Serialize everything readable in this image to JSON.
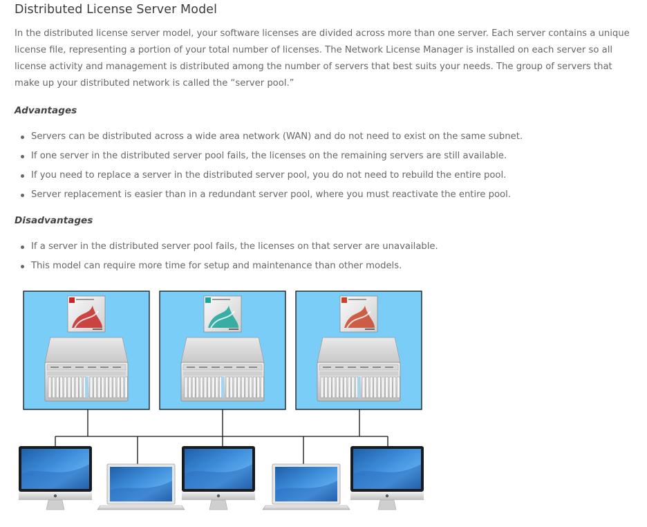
{
  "title": "Distributed License Server Model",
  "intro": "In the distributed license server model, your software licenses are divided across more than one server. Each server contains a unique license file, representing a portion of your total number of licenses. The Network License Manager is installed on each server so all license activity and management is distributed among the number of servers that best suits your needs. The group of servers that make up your distributed network is called the “server pool.”",
  "advantages": {
    "heading": "Advantages",
    "items": [
      "Servers can be distributed across a wide area network (WAN) and do not need to exist on the same subnet.",
      "If one server in the distributed server pool fails, the licenses on the remaining servers are still available.",
      "If you need to replace a server in the distributed server pool, you do not need to rebuild the entire pool.",
      "Server replacement is easier than in a redundant server pool, where you must reactivate the entire pool."
    ]
  },
  "disadvantages": {
    "heading": "Disadvantages",
    "items": [
      "If a server in the distributed server pool fails, the licenses on that server are unavailable.",
      "This model can require more time for setup and maintenance than other models."
    ]
  },
  "diagram": {
    "panel_color": "#7acdf6",
    "servers": [
      {
        "product_icon": "autodesk-autocad-box-icon",
        "accent": "#c62828"
      },
      {
        "product_icon": "autodesk-maya-box-icon",
        "accent": "#1aa59a"
      },
      {
        "product_icon": "autodesk-alias-box-icon",
        "accent": "#c8452c"
      }
    ],
    "clients": [
      "desktop",
      "laptop",
      "desktop",
      "laptop",
      "desktop"
    ]
  }
}
